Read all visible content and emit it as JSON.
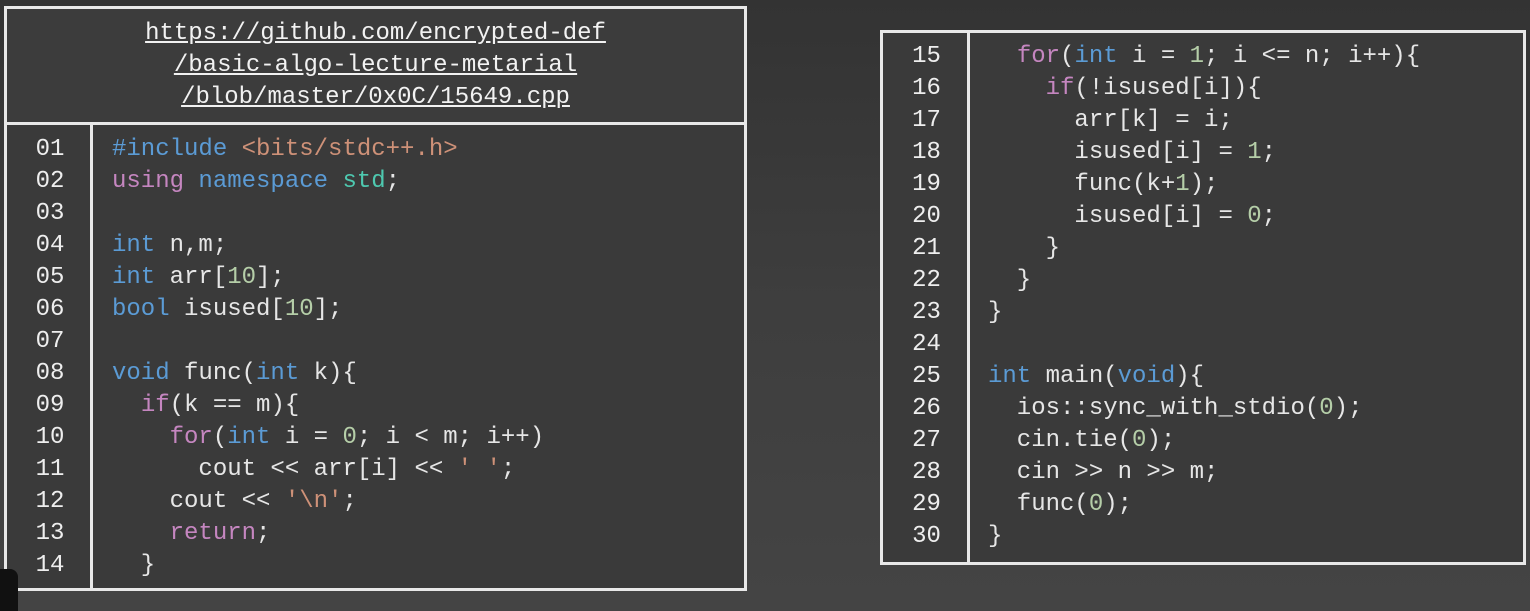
{
  "url_lines": [
    "https://github.com/encrypted-def",
    "/basic-algo-lecture-metarial",
    "/blob/master/0x0C/15649.cpp"
  ],
  "left_line_numbers": [
    "01",
    "02",
    "03",
    "04",
    "05",
    "06",
    "07",
    "08",
    "09",
    "10",
    "11",
    "12",
    "13",
    "14"
  ],
  "right_line_numbers": [
    "15",
    "16",
    "17",
    "18",
    "19",
    "20",
    "21",
    "22",
    "23",
    "24",
    "25",
    "26",
    "27",
    "28",
    "29",
    "30"
  ],
  "left_code": [
    [
      {
        "t": "#include ",
        "c": "k"
      },
      {
        "t": "<bits/stdc++.h>",
        "c": "s"
      }
    ],
    [
      {
        "t": "using ",
        "c": "c"
      },
      {
        "t": "namespace ",
        "c": "k"
      },
      {
        "t": "std",
        "c": "t"
      },
      {
        "t": ";",
        "c": ""
      }
    ],
    [],
    [
      {
        "t": "int ",
        "c": "k"
      },
      {
        "t": "n,m;",
        "c": ""
      }
    ],
    [
      {
        "t": "int ",
        "c": "k"
      },
      {
        "t": "arr[",
        "c": ""
      },
      {
        "t": "10",
        "c": "n"
      },
      {
        "t": "];",
        "c": ""
      }
    ],
    [
      {
        "t": "bool ",
        "c": "k"
      },
      {
        "t": "isused[",
        "c": ""
      },
      {
        "t": "10",
        "c": "n"
      },
      {
        "t": "];",
        "c": ""
      }
    ],
    [],
    [
      {
        "t": "void ",
        "c": "k"
      },
      {
        "t": "func(",
        "c": ""
      },
      {
        "t": "int ",
        "c": "k"
      },
      {
        "t": "k){",
        "c": ""
      }
    ],
    [
      {
        "t": "  ",
        "c": ""
      },
      {
        "t": "if",
        "c": "c"
      },
      {
        "t": "(k == m){",
        "c": ""
      }
    ],
    [
      {
        "t": "    ",
        "c": ""
      },
      {
        "t": "for",
        "c": "c"
      },
      {
        "t": "(",
        "c": ""
      },
      {
        "t": "int ",
        "c": "k"
      },
      {
        "t": "i = ",
        "c": ""
      },
      {
        "t": "0",
        "c": "n"
      },
      {
        "t": "; i < m; i++)",
        "c": ""
      }
    ],
    [
      {
        "t": "      cout << arr[i] << ",
        "c": ""
      },
      {
        "t": "' '",
        "c": "s"
      },
      {
        "t": ";",
        "c": ""
      }
    ],
    [
      {
        "t": "    cout << ",
        "c": ""
      },
      {
        "t": "'\\n'",
        "c": "s"
      },
      {
        "t": ";",
        "c": ""
      }
    ],
    [
      {
        "t": "    ",
        "c": ""
      },
      {
        "t": "return",
        "c": "c"
      },
      {
        "t": ";",
        "c": ""
      }
    ],
    [
      {
        "t": "  }",
        "c": ""
      }
    ]
  ],
  "right_code": [
    [
      {
        "t": "  ",
        "c": ""
      },
      {
        "t": "for",
        "c": "c"
      },
      {
        "t": "(",
        "c": ""
      },
      {
        "t": "int ",
        "c": "k"
      },
      {
        "t": "i = ",
        "c": ""
      },
      {
        "t": "1",
        "c": "n"
      },
      {
        "t": "; i <= n; i++){",
        "c": ""
      }
    ],
    [
      {
        "t": "    ",
        "c": ""
      },
      {
        "t": "if",
        "c": "c"
      },
      {
        "t": "(!isused[i]){",
        "c": ""
      }
    ],
    [
      {
        "t": "      arr[k] = i;",
        "c": ""
      }
    ],
    [
      {
        "t": "      isused[i] = ",
        "c": ""
      },
      {
        "t": "1",
        "c": "n"
      },
      {
        "t": ";",
        "c": ""
      }
    ],
    [
      {
        "t": "      func(k+",
        "c": ""
      },
      {
        "t": "1",
        "c": "n"
      },
      {
        "t": ");",
        "c": ""
      }
    ],
    [
      {
        "t": "      isused[i] = ",
        "c": ""
      },
      {
        "t": "0",
        "c": "n"
      },
      {
        "t": ";",
        "c": ""
      }
    ],
    [
      {
        "t": "    }",
        "c": ""
      }
    ],
    [
      {
        "t": "  }",
        "c": ""
      }
    ],
    [
      {
        "t": "}",
        "c": ""
      }
    ],
    [],
    [
      {
        "t": "int ",
        "c": "k"
      },
      {
        "t": "main(",
        "c": ""
      },
      {
        "t": "void",
        "c": "k"
      },
      {
        "t": "){",
        "c": ""
      }
    ],
    [
      {
        "t": "  ios::sync_with_stdio(",
        "c": ""
      },
      {
        "t": "0",
        "c": "n"
      },
      {
        "t": ");",
        "c": ""
      }
    ],
    [
      {
        "t": "  cin.tie(",
        "c": ""
      },
      {
        "t": "0",
        "c": "n"
      },
      {
        "t": ");",
        "c": ""
      }
    ],
    [
      {
        "t": "  cin >> n >> m;",
        "c": ""
      }
    ],
    [
      {
        "t": "  func(",
        "c": ""
      },
      {
        "t": "0",
        "c": "n"
      },
      {
        "t": ");",
        "c": ""
      }
    ],
    [
      {
        "t": "}",
        "c": ""
      }
    ]
  ]
}
